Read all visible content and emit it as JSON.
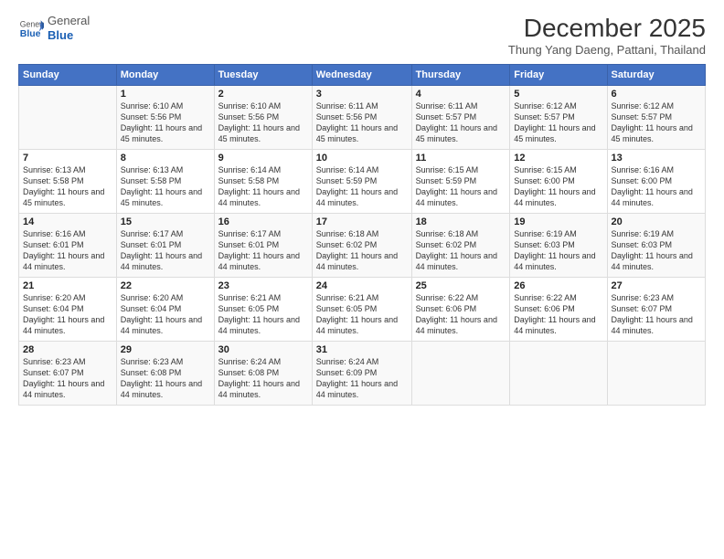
{
  "logo": {
    "general": "General",
    "blue": "Blue"
  },
  "title": {
    "month_year": "December 2025",
    "location": "Thung Yang Daeng, Pattani, Thailand"
  },
  "headers": [
    "Sunday",
    "Monday",
    "Tuesday",
    "Wednesday",
    "Thursday",
    "Friday",
    "Saturday"
  ],
  "weeks": [
    [
      {
        "day": "",
        "info": ""
      },
      {
        "day": "1",
        "info": "Sunrise: 6:10 AM\nSunset: 5:56 PM\nDaylight: 11 hours and 45 minutes."
      },
      {
        "day": "2",
        "info": "Sunrise: 6:10 AM\nSunset: 5:56 PM\nDaylight: 11 hours and 45 minutes."
      },
      {
        "day": "3",
        "info": "Sunrise: 6:11 AM\nSunset: 5:56 PM\nDaylight: 11 hours and 45 minutes."
      },
      {
        "day": "4",
        "info": "Sunrise: 6:11 AM\nSunset: 5:57 PM\nDaylight: 11 hours and 45 minutes."
      },
      {
        "day": "5",
        "info": "Sunrise: 6:12 AM\nSunset: 5:57 PM\nDaylight: 11 hours and 45 minutes."
      },
      {
        "day": "6",
        "info": "Sunrise: 6:12 AM\nSunset: 5:57 PM\nDaylight: 11 hours and 45 minutes."
      }
    ],
    [
      {
        "day": "7",
        "info": "Sunrise: 6:13 AM\nSunset: 5:58 PM\nDaylight: 11 hours and 45 minutes."
      },
      {
        "day": "8",
        "info": "Sunrise: 6:13 AM\nSunset: 5:58 PM\nDaylight: 11 hours and 45 minutes."
      },
      {
        "day": "9",
        "info": "Sunrise: 6:14 AM\nSunset: 5:58 PM\nDaylight: 11 hours and 44 minutes."
      },
      {
        "day": "10",
        "info": "Sunrise: 6:14 AM\nSunset: 5:59 PM\nDaylight: 11 hours and 44 minutes."
      },
      {
        "day": "11",
        "info": "Sunrise: 6:15 AM\nSunset: 5:59 PM\nDaylight: 11 hours and 44 minutes."
      },
      {
        "day": "12",
        "info": "Sunrise: 6:15 AM\nSunset: 6:00 PM\nDaylight: 11 hours and 44 minutes."
      },
      {
        "day": "13",
        "info": "Sunrise: 6:16 AM\nSunset: 6:00 PM\nDaylight: 11 hours and 44 minutes."
      }
    ],
    [
      {
        "day": "14",
        "info": "Sunrise: 6:16 AM\nSunset: 6:01 PM\nDaylight: 11 hours and 44 minutes."
      },
      {
        "day": "15",
        "info": "Sunrise: 6:17 AM\nSunset: 6:01 PM\nDaylight: 11 hours and 44 minutes."
      },
      {
        "day": "16",
        "info": "Sunrise: 6:17 AM\nSunset: 6:01 PM\nDaylight: 11 hours and 44 minutes."
      },
      {
        "day": "17",
        "info": "Sunrise: 6:18 AM\nSunset: 6:02 PM\nDaylight: 11 hours and 44 minutes."
      },
      {
        "day": "18",
        "info": "Sunrise: 6:18 AM\nSunset: 6:02 PM\nDaylight: 11 hours and 44 minutes."
      },
      {
        "day": "19",
        "info": "Sunrise: 6:19 AM\nSunset: 6:03 PM\nDaylight: 11 hours and 44 minutes."
      },
      {
        "day": "20",
        "info": "Sunrise: 6:19 AM\nSunset: 6:03 PM\nDaylight: 11 hours and 44 minutes."
      }
    ],
    [
      {
        "day": "21",
        "info": "Sunrise: 6:20 AM\nSunset: 6:04 PM\nDaylight: 11 hours and 44 minutes."
      },
      {
        "day": "22",
        "info": "Sunrise: 6:20 AM\nSunset: 6:04 PM\nDaylight: 11 hours and 44 minutes."
      },
      {
        "day": "23",
        "info": "Sunrise: 6:21 AM\nSunset: 6:05 PM\nDaylight: 11 hours and 44 minutes."
      },
      {
        "day": "24",
        "info": "Sunrise: 6:21 AM\nSunset: 6:05 PM\nDaylight: 11 hours and 44 minutes."
      },
      {
        "day": "25",
        "info": "Sunrise: 6:22 AM\nSunset: 6:06 PM\nDaylight: 11 hours and 44 minutes."
      },
      {
        "day": "26",
        "info": "Sunrise: 6:22 AM\nSunset: 6:06 PM\nDaylight: 11 hours and 44 minutes."
      },
      {
        "day": "27",
        "info": "Sunrise: 6:23 AM\nSunset: 6:07 PM\nDaylight: 11 hours and 44 minutes."
      }
    ],
    [
      {
        "day": "28",
        "info": "Sunrise: 6:23 AM\nSunset: 6:07 PM\nDaylight: 11 hours and 44 minutes."
      },
      {
        "day": "29",
        "info": "Sunrise: 6:23 AM\nSunset: 6:08 PM\nDaylight: 11 hours and 44 minutes."
      },
      {
        "day": "30",
        "info": "Sunrise: 6:24 AM\nSunset: 6:08 PM\nDaylight: 11 hours and 44 minutes."
      },
      {
        "day": "31",
        "info": "Sunrise: 6:24 AM\nSunset: 6:09 PM\nDaylight: 11 hours and 44 minutes."
      },
      {
        "day": "",
        "info": ""
      },
      {
        "day": "",
        "info": ""
      },
      {
        "day": "",
        "info": ""
      }
    ]
  ]
}
